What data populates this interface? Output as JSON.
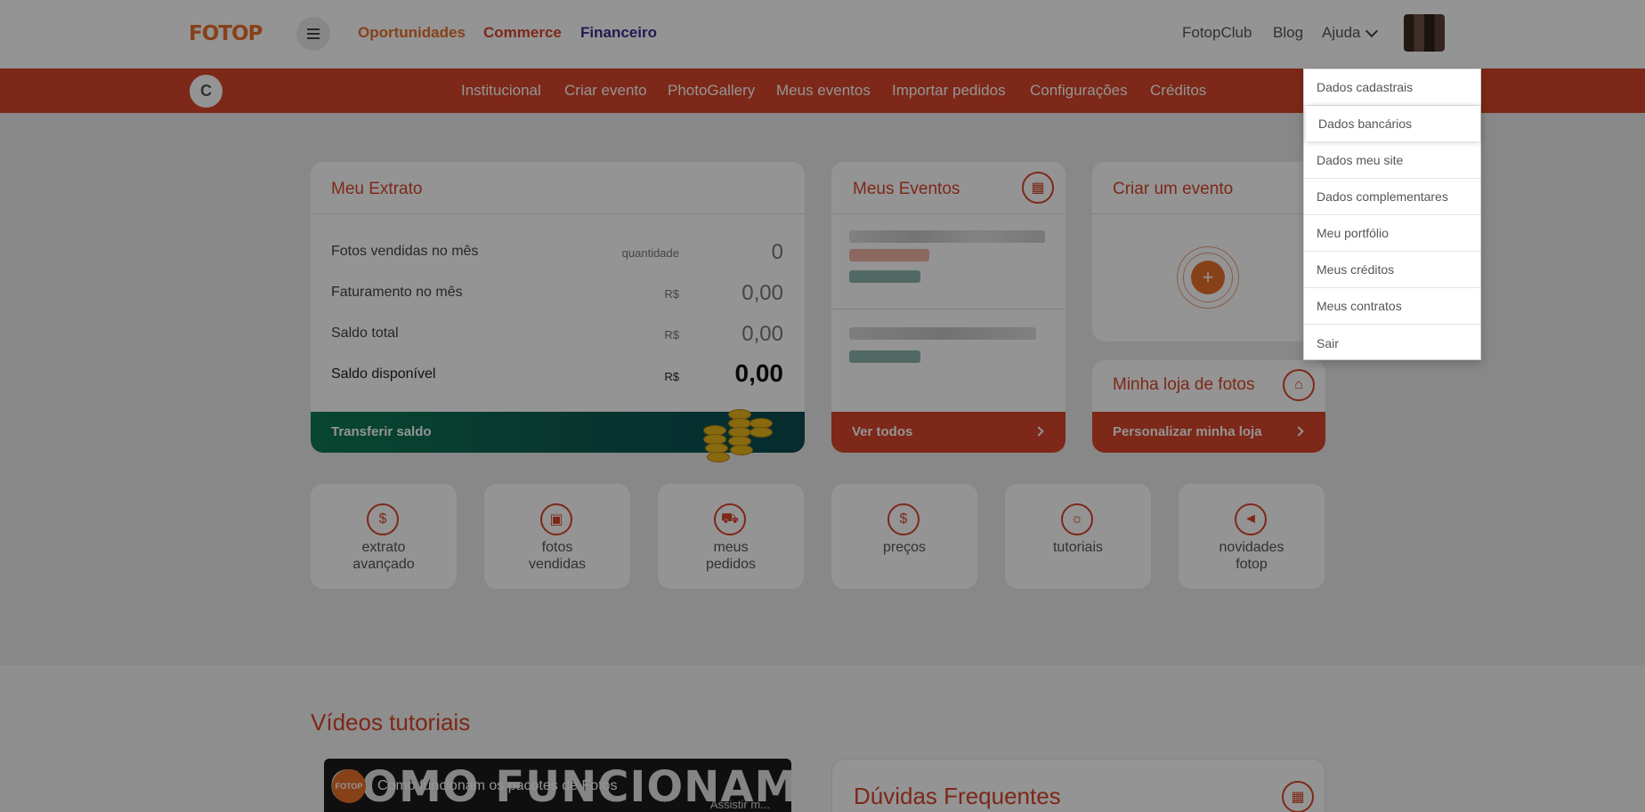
{
  "header": {
    "logo": "FOTOP",
    "menu_icon": "hamburger-icon",
    "links": [
      "Oportunidades",
      "Commerce",
      "Financeiro"
    ],
    "right_links": [
      "FotopClub",
      "Blog",
      "Ajuda"
    ]
  },
  "subnav": {
    "badge": "C",
    "items": [
      "Institucional",
      "Criar evento",
      "PhotoGallery",
      "Meus eventos",
      "Importar pedidos",
      "Configurações",
      "Créditos"
    ]
  },
  "extrato": {
    "title": "Meu Extrato",
    "rows": [
      {
        "label": "Fotos vendidas no mês",
        "unit": "quantidade",
        "value": "0"
      },
      {
        "label": "Faturamento no mês",
        "unit": "R$",
        "value": "0,00"
      },
      {
        "label": "Saldo total",
        "unit": "R$",
        "value": "0,00"
      },
      {
        "label": "Saldo disponível",
        "unit": "R$",
        "value": "0,00"
      }
    ],
    "transfer_label": "Transferir saldo"
  },
  "eventos": {
    "title": "Meus Eventos",
    "footer": "Ver todos"
  },
  "criar": {
    "title": "Criar um evento"
  },
  "loja": {
    "title": "Minha loja de fotos",
    "footer": "Personalizar minha loja"
  },
  "tiles": [
    {
      "label": "extrato avançado",
      "icon": "dollar-icon"
    },
    {
      "label": "fotos vendidas",
      "icon": "image-icon"
    },
    {
      "label": "meus pedidos",
      "icon": "cart-icon"
    },
    {
      "label": "preços",
      "icon": "dollar-icon"
    },
    {
      "label": "tutoriais",
      "icon": "lightbulb-icon"
    },
    {
      "label": "novidades fotop",
      "icon": "megaphone-icon"
    }
  ],
  "videos": {
    "title": "Vídeos tutoriais",
    "video_big_text": "COMO FUNCIONAM",
    "video_logo": "FOTOP",
    "video_caption": "Como funcionam os pacotes de Fotos",
    "assist": "Assistir m..."
  },
  "faq": {
    "title": "Dúvidas Frequentes"
  },
  "dropdown": {
    "items": [
      "Dados cadastrais",
      "Dados bancários",
      "Dados meu site",
      "Dados complementares",
      "Meu portfólio",
      "Meus créditos",
      "Meus contratos",
      "Sair"
    ],
    "highlighted": "Dados bancários"
  },
  "colors": {
    "accent": "#d8452a",
    "orange": "#e8702a",
    "financeiro": "#3b2f8e",
    "transfer_green": "#0f7a55"
  }
}
